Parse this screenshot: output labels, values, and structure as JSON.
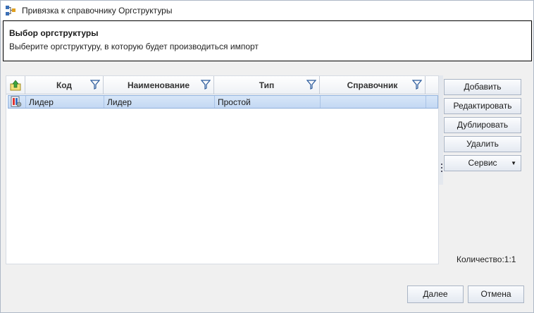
{
  "window": {
    "title": "Привязка к справочнику Оргструктуры"
  },
  "header": {
    "title": "Выбор оргструктуры",
    "subtitle": "Выберите оргструктуру, в которую будет производиться импорт"
  },
  "grid": {
    "columns": [
      "Код",
      "Наименование",
      "Тип",
      "Справочник"
    ],
    "rows": [
      {
        "code": "Лидер",
        "name": "Лидер",
        "type": "Простой",
        "directory": ""
      }
    ]
  },
  "actions": {
    "add": "Добавить",
    "edit": "Редактировать",
    "duplicate": "Дублировать",
    "delete": "Удалить",
    "service": "Сервис"
  },
  "count_label": "Количество:1:1",
  "footer": {
    "next": "Далее",
    "cancel": "Отмена"
  },
  "colors": {
    "selected_row": "#c9dcf5",
    "accent": "#4a7ab8"
  },
  "icons": {
    "app": "hierarchy-link-icon",
    "row": "org-structure-icon",
    "header": "level-up-icon",
    "filter": "filter-icon"
  }
}
